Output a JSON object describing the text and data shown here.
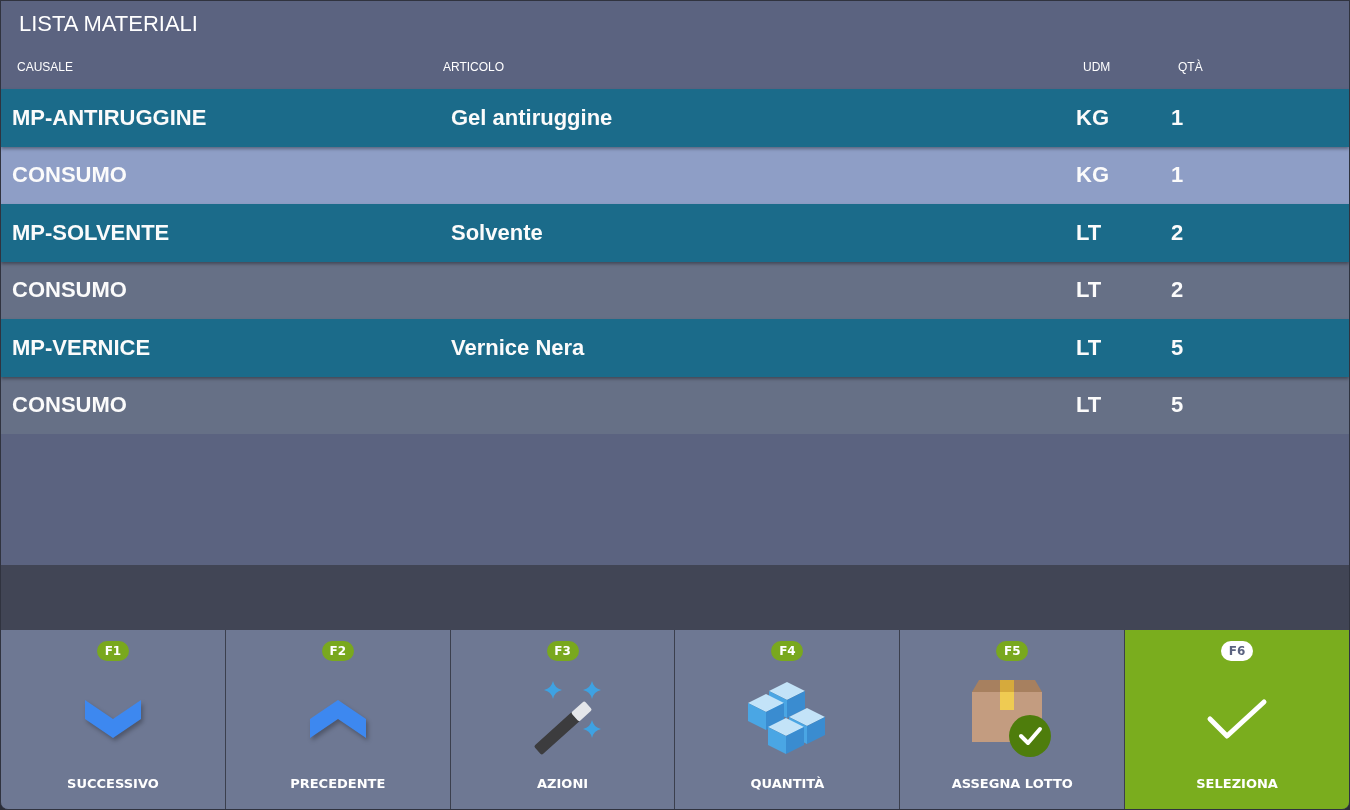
{
  "title": "LISTA MATERIALI",
  "table": {
    "columns": [
      "CAUSALE",
      "ARTICOLO",
      "UDM",
      "QTÀ"
    ],
    "rows": [
      {
        "kind": "article",
        "selected": false,
        "causale": "MP-ANTIRUGGINE",
        "articolo": "Gel antiruggine",
        "udm": "KG",
        "qta": "1"
      },
      {
        "kind": "consumption",
        "selected": true,
        "causale": "CONSUMO",
        "udm": "KG",
        "qta": "1"
      },
      {
        "kind": "article",
        "selected": false,
        "causale": "MP-SOLVENTE",
        "articolo": "Solvente",
        "udm": "LT",
        "qta": "2"
      },
      {
        "kind": "consumption",
        "selected": false,
        "causale": "CONSUMO",
        "udm": "LT",
        "qta": "2"
      },
      {
        "kind": "article",
        "selected": false,
        "causale": "MP-VERNICE",
        "articolo": "Vernice Nera",
        "udm": "LT",
        "qta": "5"
      },
      {
        "kind": "consumption",
        "selected": false,
        "causale": "CONSUMO",
        "udm": "LT",
        "qta": "5"
      }
    ]
  },
  "buttons": [
    {
      "key": "F1",
      "label": "SUCCESSIVO",
      "kind": "down",
      "primary": false
    },
    {
      "key": "F2",
      "label": "PRECEDENTE",
      "kind": "up",
      "primary": false
    },
    {
      "key": "F3",
      "label": "AZIONI",
      "kind": "wand",
      "primary": false
    },
    {
      "key": "F4",
      "label": "QUANTITÀ",
      "kind": "cubes",
      "primary": false
    },
    {
      "key": "F5",
      "label": "ASSEGNA LOTTO",
      "kind": "box-check",
      "primary": false
    },
    {
      "key": "F6",
      "label": "SELEZIONA",
      "kind": "check",
      "primary": true
    }
  ]
}
